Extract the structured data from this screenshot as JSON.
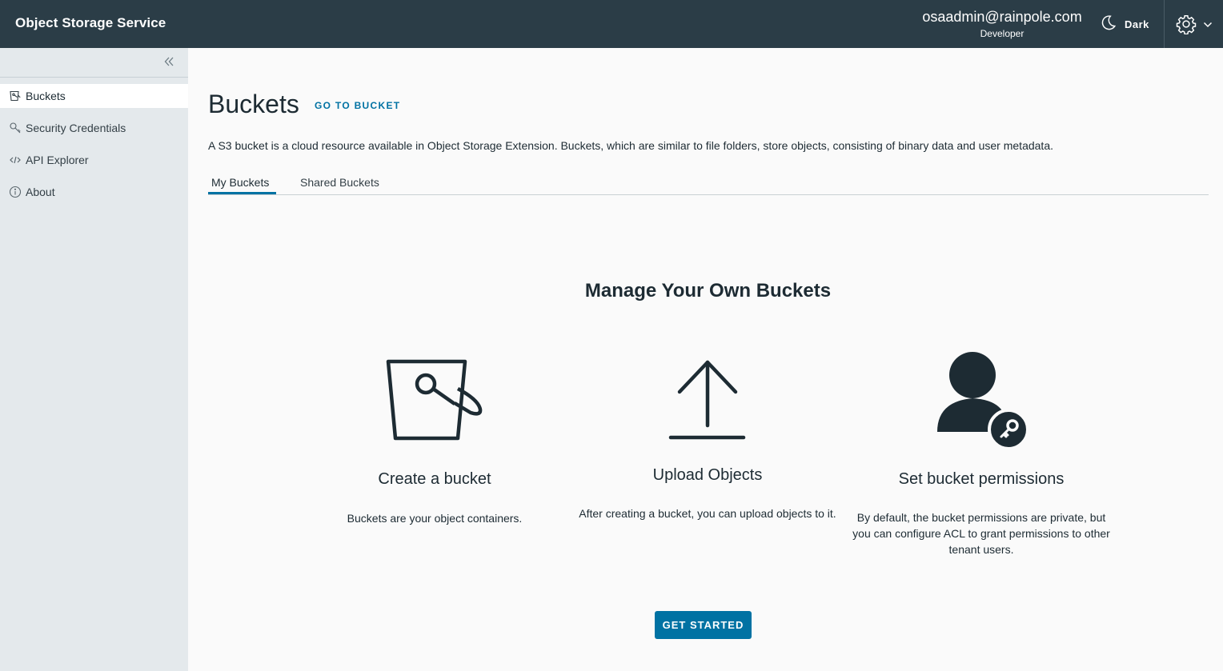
{
  "header": {
    "app_title": "Object Storage Service",
    "user_email": "osaadmin@rainpole.com",
    "user_role": "Developer",
    "theme_label": "Dark",
    "icons": [
      "moon-icon",
      "gear-icon",
      "chevron-down-icon"
    ]
  },
  "sidebar": {
    "collapse_icon": "double-chevron-left-icon",
    "items": [
      {
        "label": "Buckets",
        "icon": "bucket-icon",
        "active": true
      },
      {
        "label": "Security Credentials",
        "icon": "key-icon",
        "active": false
      },
      {
        "label": "API Explorer",
        "icon": "code-icon",
        "active": false
      },
      {
        "label": "About",
        "icon": "info-icon",
        "active": false
      }
    ]
  },
  "main": {
    "title": "Buckets",
    "go_to_bucket": "GO TO BUCKET",
    "description": "A S3 bucket is a cloud resource available in Object Storage Extension. Buckets, which are similar to file folders, store objects, consisting of binary data and user metadata.",
    "tabs": [
      {
        "label": "My Buckets",
        "active": true
      },
      {
        "label": "Shared Buckets",
        "active": false
      }
    ],
    "section_title": "Manage Your Own Buckets",
    "features": [
      {
        "icon": "bucket-icon",
        "title": "Create a bucket",
        "description": "Buckets are your object containers."
      },
      {
        "icon": "upload-icon",
        "title": "Upload Objects",
        "description": "After creating a bucket, you can upload objects to it."
      },
      {
        "icon": "user-key-icon",
        "title": "Set bucket permissions",
        "description": "By default, the bucket permissions are private, but you can configure ACL to grant permissions to other tenant users."
      }
    ],
    "cta_label": "GET STARTED"
  },
  "colors": {
    "header_bg": "#2b3d47",
    "sidebar_bg": "#e4e9ec",
    "accent": "#0072a3",
    "content_bg": "#fafafa"
  }
}
